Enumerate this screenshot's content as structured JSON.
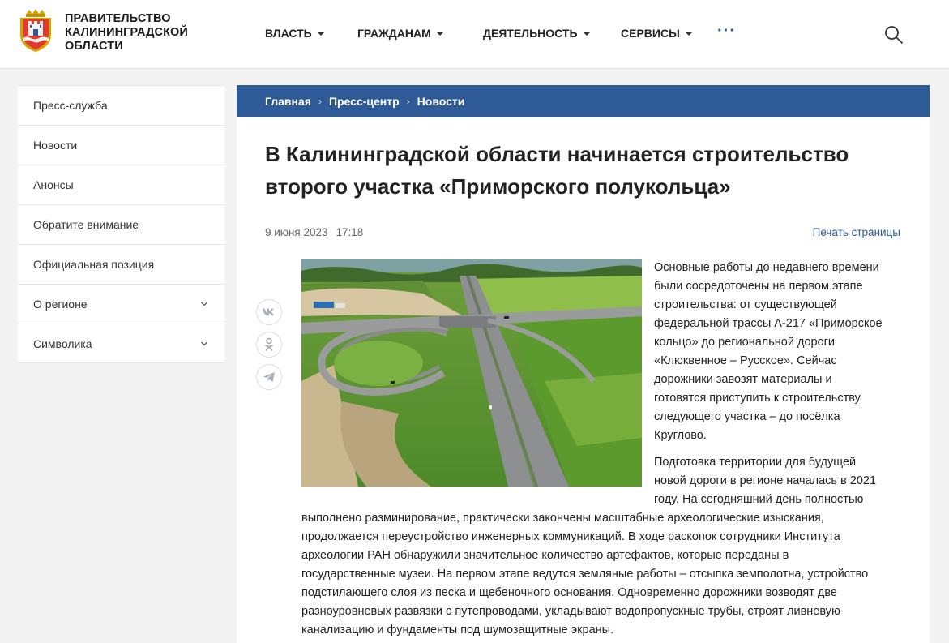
{
  "header": {
    "org_title_line1": "ПРАВИТЕЛЬСТВО",
    "org_title_line2": "КАЛИНИНГРАДСКОЙ",
    "org_title_line3": "ОБЛАСТИ",
    "nav": [
      {
        "label": "ВЛАСТЬ"
      },
      {
        "label": "ГРАЖДАНАМ"
      },
      {
        "label": "ДЕЯТЕЛЬНОСТЬ"
      },
      {
        "label": "СЕРВИСЫ"
      }
    ],
    "more_label": "···"
  },
  "sidebar": {
    "items": [
      {
        "label": "Пресс-служба",
        "expandable": false
      },
      {
        "label": "Новости",
        "expandable": false
      },
      {
        "label": "Анонсы",
        "expandable": false
      },
      {
        "label": "Обратите внимание",
        "expandable": false
      },
      {
        "label": "Официальная позиция",
        "expandable": false
      },
      {
        "label": "О регионе",
        "expandable": true
      },
      {
        "label": "Символика",
        "expandable": true
      }
    ]
  },
  "breadcrumb": {
    "items": [
      "Главная",
      "Пресс-центр",
      "Новости"
    ],
    "separator": "›"
  },
  "article": {
    "title_line1": "В Калининградской области начинается строительство",
    "title_line2": "второго участка «Приморского полукольца»",
    "date": "9 июня 2023",
    "time": "17:18",
    "print_label": "Печать страницы",
    "share_icons": [
      "vk-icon",
      "odnoklassniki-icon",
      "telegram-icon"
    ],
    "p1_lines": [
      "Основные работы до недавнего времени",
      "были сосредоточены на первом этапе",
      "строительства: от существующей",
      "федеральной трассы А-217 «Приморское",
      "кольцо» до региональной дороги",
      "«Клюквенное – Русское». Сейчас",
      "дорожники завозят материалы и",
      "готовятся приступить к строительству",
      "следующего участка – до посёлка",
      "Круглово."
    ],
    "p2_right_lines": [
      "Подготовка территории для будущей",
      "новой дороги в регионе началась в 2021",
      "году. На сегодняшний день полностью"
    ],
    "p2_full_lines": [
      "выполнено разминирование, практически закончены масштабные археологические изыскания,",
      "продолжается переустройство инженерных коммуникаций. В ходе раскопок сотрудники Института",
      "археологии РАН обнаружили значительное количество артефактов, которые переданы в",
      "государственные музеи. На первом этапе ведутся земляные работы – отсыпка земполотна, устройство",
      "подстилающего слоя из песка и щебеночного основания. Одновременно дорожники возводят две",
      "разноуровневых развязки с путепроводами, укладывают водопропускные трубы, строят ливневую",
      "канализацию и фундаменты под шумозащитные экраны."
    ]
  },
  "colors": {
    "accent": "#2e5a97",
    "crumb_bg": "#2e5a97",
    "link": "#2e5a97"
  }
}
